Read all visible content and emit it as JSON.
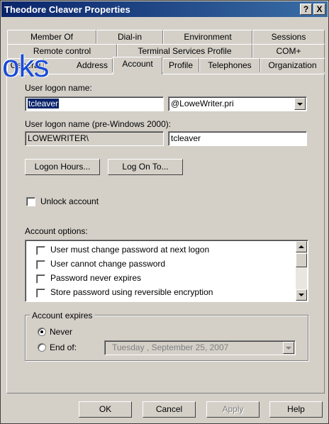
{
  "window": {
    "title": "Theodore Cleaver Properties",
    "help_btn": "?",
    "close_btn": "X"
  },
  "watermark": "oks",
  "tabs_row1": [
    "Member Of",
    "Dial-in",
    "Environment",
    "Sessions"
  ],
  "tabs_row2": [
    "Remote control",
    "Terminal Services Profile",
    "COM+"
  ],
  "tabs_row3": [
    "General",
    "Address",
    "Account",
    "Profile",
    "Telephones",
    "Organization"
  ],
  "active_tab": "Account",
  "account": {
    "logon_name_label": "User logon name:",
    "logon_name_value": "tcleaver",
    "domain_value": "@LoweWriter.pri",
    "pre2000_label": "User logon name (pre-Windows 2000):",
    "pre2000_domain": "LOWEWRITER\\",
    "pre2000_name": "tcleaver",
    "logon_hours_btn": "Logon Hours...",
    "log_on_to_btn": "Log On To...",
    "unlock_label": "Unlock account",
    "options_label": "Account options:",
    "options": [
      "User must change password at next logon",
      "User cannot change password",
      "Password never expires",
      "Store password using reversible encryption"
    ],
    "expires_label": "Account expires",
    "never_label": "Never",
    "end_of_label": "End of:",
    "end_of_date": "Tuesday  , September 25, 2007",
    "expires_selected": "Never"
  },
  "buttons": {
    "ok": "OK",
    "cancel": "Cancel",
    "apply": "Apply",
    "help": "Help"
  }
}
